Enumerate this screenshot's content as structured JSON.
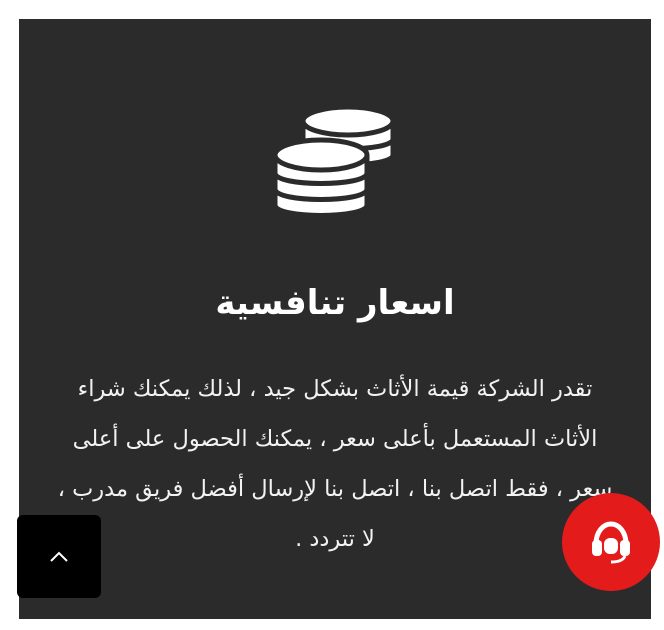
{
  "feature": {
    "icon": "coins-icon",
    "title": "اسعار تنافسية",
    "description": "تقدر الشركة قيمة الأثاث بشكل جيد ، لذلك يمكنك شراء الأثاث المستعمل بأعلى سعر ، يمكنك الحصول على أعلى سعر ، فقط اتصل بنا ، اتصل بنا لإرسال أفضل فريق مدرب ، لا تتردد ."
  },
  "floating": {
    "scroll_top_icon": "chevron-up-icon",
    "support_icon": "headset-icon",
    "support_color": "#e31b1b"
  },
  "colors": {
    "card_background": "#2b2b2b",
    "text": "#ffffff"
  }
}
